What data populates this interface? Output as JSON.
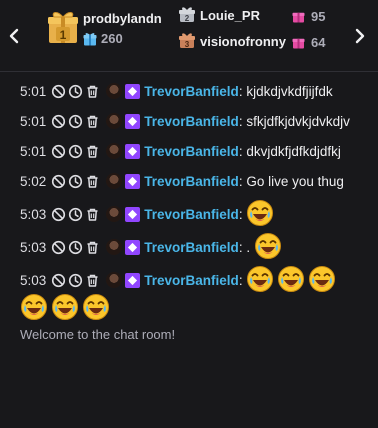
{
  "leaderboard": {
    "first": {
      "rank": "1",
      "name": "prodbylandn",
      "count": "260"
    },
    "second": {
      "rank": "2",
      "name": "Louie_PR",
      "count": "95"
    },
    "third": {
      "rank": "3",
      "name": "visionofronny",
      "count": "64"
    }
  },
  "colors": {
    "username": "#4ab6e8",
    "badge": "#9146ff",
    "background": "#18181b",
    "gift_pink": "#e54ba3",
    "gift_blue": "#5ab8f0"
  },
  "messages": [
    {
      "time": "5:01",
      "user": "TrevorBanfield",
      "text": "kjdkdjvkdfjijfdk",
      "emotes": 0
    },
    {
      "time": "5:01",
      "user": "TrevorBanfield",
      "text": "sfkjdfkjdvkjdvkdjv",
      "emotes": 0
    },
    {
      "time": "5:01",
      "user": "TrevorBanfield",
      "text": "dkvjdkfjdfkdjdfkj",
      "emotes": 0
    },
    {
      "time": "5:02",
      "user": "TrevorBanfield",
      "text": "Go live you thug",
      "emotes": 0
    },
    {
      "time": "5:03",
      "user": "TrevorBanfield",
      "text": "",
      "emotes": 1
    },
    {
      "time": "5:03",
      "user": "TrevorBanfield",
      "text": ".",
      "emotes": 1
    },
    {
      "time": "5:03",
      "user": "TrevorBanfield",
      "text": "",
      "emotes": 6
    }
  ],
  "system_message": "Welcome to the chat room!"
}
